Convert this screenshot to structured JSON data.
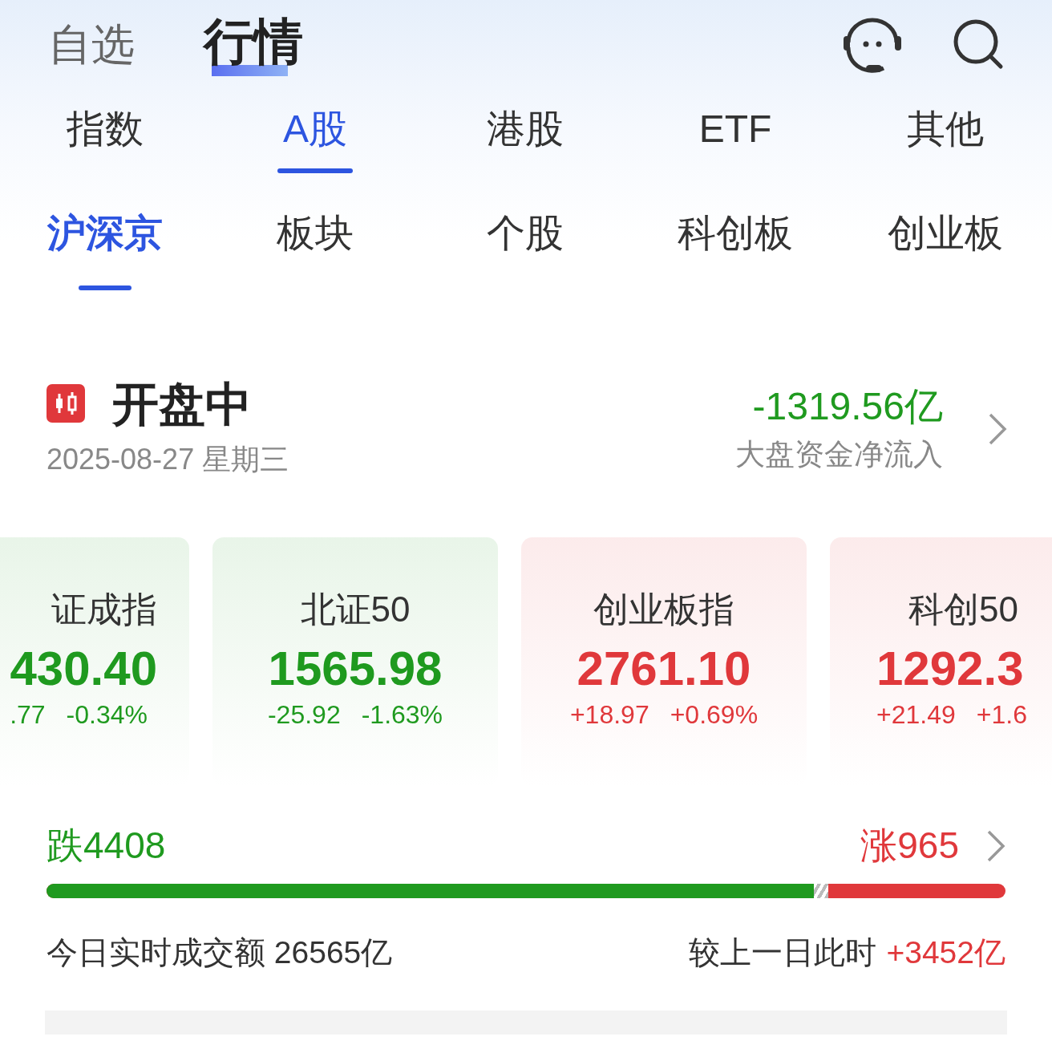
{
  "top_tabs": [
    {
      "label": "自选",
      "selected": false
    },
    {
      "label": "行情",
      "selected": true
    }
  ],
  "market_tabs": [
    {
      "label": "指数",
      "selected": false
    },
    {
      "label": "A股",
      "selected": true
    },
    {
      "label": "港股",
      "selected": false
    },
    {
      "label": "ETF",
      "selected": false
    },
    {
      "label": "其他",
      "selected": false
    }
  ],
  "sub_tabs": [
    {
      "label": "沪深京",
      "selected": true
    },
    {
      "label": "板块",
      "selected": false
    },
    {
      "label": "个股",
      "selected": false
    },
    {
      "label": "科创板",
      "selected": false
    },
    {
      "label": "创业板",
      "selected": false
    }
  ],
  "session": {
    "status": "开盘中",
    "date": "2025-08-27 星期三",
    "net_inflow": "-1319.56亿",
    "net_inflow_label": "大盘资金净流入"
  },
  "indices": [
    {
      "name": "证成指",
      "value": "430.40",
      "change": ".77",
      "percent": "-0.34%",
      "color": "#1f9a1f"
    },
    {
      "name": "北证50",
      "value": "1565.98",
      "change": "-25.92",
      "percent": "-1.63%",
      "color": "#1f9a1f"
    },
    {
      "name": "创业板指",
      "value": "2761.10",
      "change": "+18.97",
      "percent": "+0.69%",
      "color": "#e0383b"
    },
    {
      "name": "科创50",
      "value": "1292.3",
      "change": "+21.49",
      "percent": "+1.6",
      "color": "#e0383b"
    }
  ],
  "breadth": {
    "down_label": "跌4408",
    "up_label": "涨965",
    "level": 0.8
  },
  "turnover": {
    "label": "今日实时成交额 26565亿",
    "compare_label": "较上一日此时",
    "compare_value": "+3452亿"
  }
}
